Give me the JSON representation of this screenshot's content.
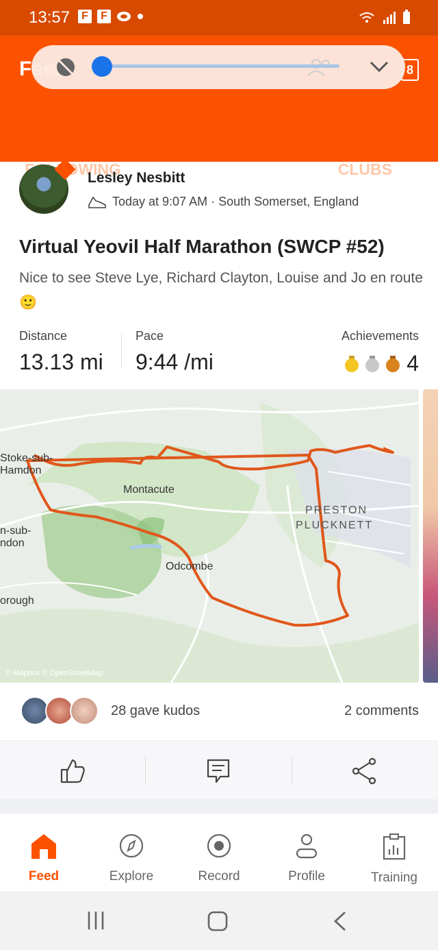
{
  "status_bar": {
    "time": "13:57",
    "fb_icon": "F"
  },
  "header": {
    "title": "Feed",
    "notifications_count": "8",
    "tabs": [
      {
        "label": "FOLLOWING",
        "active": false
      },
      {
        "label": "YOU",
        "active": true
      },
      {
        "label": "CLUBS",
        "active": false
      }
    ]
  },
  "activity": {
    "athlete_name": "Lesley Nesbitt",
    "meta": "Today at 9:07 AM · South Somerset, England",
    "title": "Virtual Yeovil Half Marathon (SWCP #52)",
    "description": "Nice to see Steve Lye, Richard Clayton, Louise  and Jo en route 🙂",
    "stats": {
      "distance_label": "Distance",
      "distance_value": "13.13 mi",
      "pace_label": "Pace",
      "pace_value": "9:44 /mi",
      "achievements_label": "Achievements",
      "achievements_count": "4"
    },
    "map_labels": {
      "stoke": "Stoke-sub-\nHamdon",
      "stoke_line1": "Stoke-sub-",
      "stoke_line2": "Hamdon",
      "montacute": "Montacute",
      "preston1": "PRESTON",
      "preston2": "PLUCKNETT",
      "nsub1": "n-sub-",
      "nsub2": "ndon",
      "odcombe": "Odcombe",
      "borough": "orough",
      "attribution": "© Mapbox © OpenStreetMap"
    },
    "kudos_text": "28 gave kudos",
    "comments_text": "2 comments"
  },
  "bottom_nav": [
    {
      "label": "Feed",
      "active": true
    },
    {
      "label": "Explore",
      "active": false
    },
    {
      "label": "Record",
      "active": false
    },
    {
      "label": "Profile",
      "active": false
    },
    {
      "label": "Training",
      "active": false
    }
  ],
  "colors": {
    "brand": "#fc5200",
    "route": "#e0571b"
  }
}
